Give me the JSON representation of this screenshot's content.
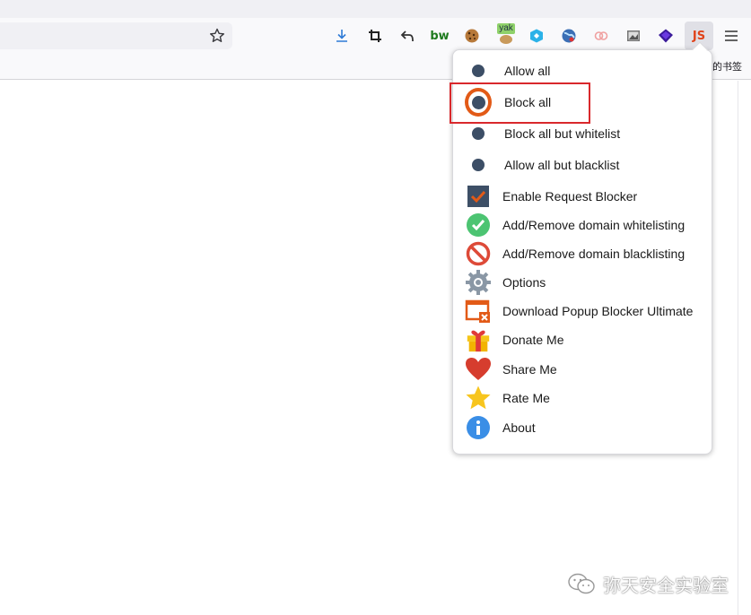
{
  "browser": {
    "bookmarks_overflow_label": "的书签",
    "toolbar_icons": [
      "download-icon",
      "screenshot-crop-icon",
      "undo-icon",
      "bw-extension-icon",
      "cookie-icon",
      "yak-extension-icon",
      "cube-extension-icon",
      "globe-extension-icon",
      "link-extension-icon",
      "photo-extension-icon",
      "layers-extension-icon",
      "js-extension-icon",
      "hamburger-menu-icon"
    ],
    "yak_label": "yak",
    "bw_label": "bw",
    "js_label": "JS"
  },
  "popup": {
    "radio_options": [
      {
        "label": "Allow all",
        "selected": false
      },
      {
        "label": "Block all",
        "selected": true
      },
      {
        "label": "Block all but whitelist",
        "selected": false
      },
      {
        "label": "Allow all but blacklist",
        "selected": false
      }
    ],
    "menu_items": [
      {
        "label": "Enable Request Blocker",
        "icon": "checkbox-icon"
      },
      {
        "label": "Add/Remove domain whitelisting",
        "icon": "green-check-icon"
      },
      {
        "label": "Add/Remove domain blacklisting",
        "icon": "red-block-icon"
      },
      {
        "label": "Options",
        "icon": "gear-icon"
      },
      {
        "label": "Download Popup Blocker Ultimate",
        "icon": "window-close-icon"
      },
      {
        "label": "Donate Me",
        "icon": "gift-icon"
      },
      {
        "label": "Share Me",
        "icon": "heart-icon"
      },
      {
        "label": "Rate Me",
        "icon": "star-icon"
      },
      {
        "label": "About",
        "icon": "info-icon"
      }
    ]
  },
  "watermark": {
    "text": "弥天安全实验室"
  },
  "colors": {
    "radio": "#3c4e66",
    "ring": "#e25a17",
    "highlight": "#d9282c"
  }
}
